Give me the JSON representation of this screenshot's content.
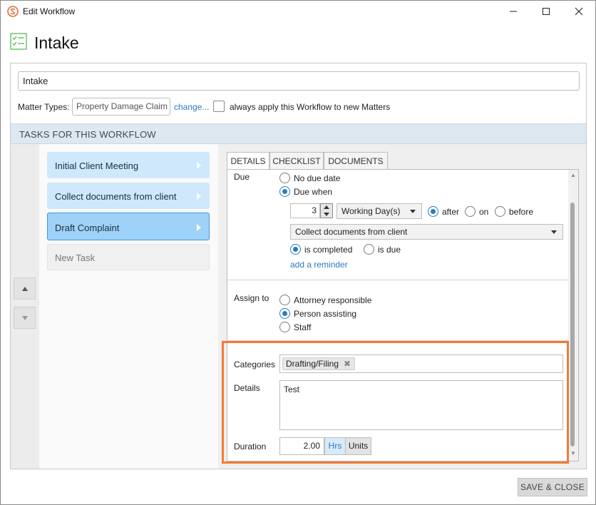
{
  "window": {
    "title": "Edit Workflow",
    "accent": "#e0703a"
  },
  "header": {
    "title": "Intake",
    "icon": "checklist-icon"
  },
  "workflow": {
    "name_value": "Intake",
    "matter_types_label": "Matter Types:",
    "matter_type_value": "Property Damage Claim",
    "change_link": "change...",
    "always_apply_label": "always apply this Workflow to new Matters",
    "always_apply_checked": false
  },
  "tasks_section": {
    "title": "TASKS FOR THIS WORKFLOW",
    "tasks": [
      {
        "label": "Initial Client Meeting"
      },
      {
        "label": "Collect documents from client"
      },
      {
        "label": "Draft Complaint",
        "selected": true
      },
      {
        "label": "New Task"
      }
    ]
  },
  "tabs": [
    "DETAILS",
    "CHECKLIST",
    "DOCUMENTS"
  ],
  "due": {
    "label": "Due",
    "no_due_date": "No due date",
    "due_when": "Due when",
    "amount": "3",
    "unit": "Working Day(s)",
    "after": "after",
    "on": "on",
    "before": "before",
    "related_task": "Collect documents from client",
    "is_completed": "is completed",
    "is_due": "is due",
    "add_reminder": "add a reminder"
  },
  "assign": {
    "label": "Assign to",
    "options": [
      "Attorney responsible",
      "Person assisting",
      "Staff"
    ],
    "selected": "Person assisting"
  },
  "categories": {
    "label": "Categories",
    "chips": [
      "Drafting/Filing"
    ]
  },
  "details": {
    "label": "Details",
    "value": "Test"
  },
  "duration": {
    "label": "Duration",
    "value": "2.00",
    "hrs": "Hrs",
    "units": "Units"
  },
  "footer": {
    "save_close": "SAVE & CLOSE"
  },
  "colors": {
    "highlight": "#ef7b3a",
    "link": "#2b7bc1",
    "task_bg": "#cfe8fb",
    "task_selected_bg": "#9fd2f8",
    "section_bg": "#dde8f1"
  }
}
